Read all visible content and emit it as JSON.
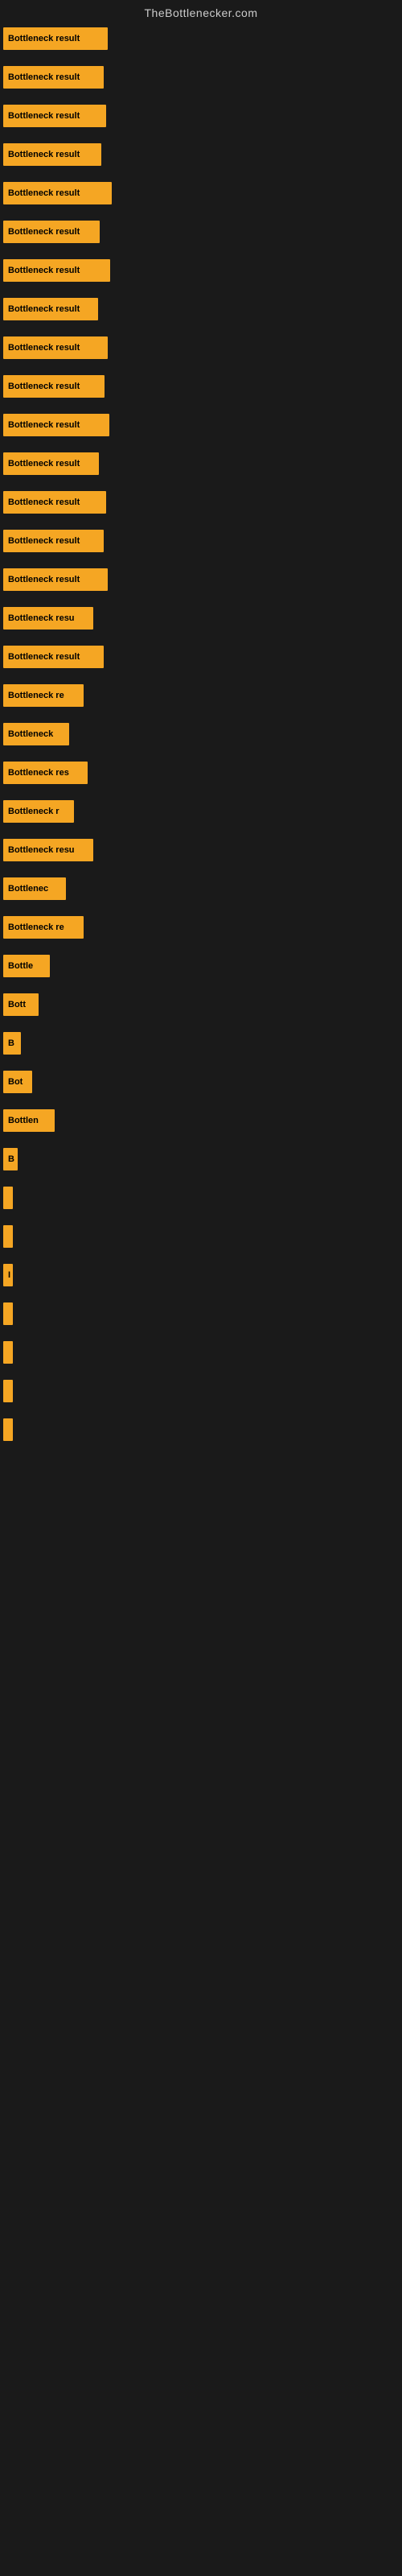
{
  "site": {
    "title": "TheBottlenecker.com"
  },
  "bars": [
    {
      "id": 1,
      "label": "Bottleneck result",
      "width": 130
    },
    {
      "id": 2,
      "label": "Bottleneck result",
      "width": 125
    },
    {
      "id": 3,
      "label": "Bottleneck result",
      "width": 128
    },
    {
      "id": 4,
      "label": "Bottleneck result",
      "width": 122
    },
    {
      "id": 5,
      "label": "Bottleneck result",
      "width": 135
    },
    {
      "id": 6,
      "label": "Bottleneck result",
      "width": 120
    },
    {
      "id": 7,
      "label": "Bottleneck result",
      "width": 133
    },
    {
      "id": 8,
      "label": "Bottleneck result",
      "width": 118
    },
    {
      "id": 9,
      "label": "Bottleneck result",
      "width": 130
    },
    {
      "id": 10,
      "label": "Bottleneck result",
      "width": 126
    },
    {
      "id": 11,
      "label": "Bottleneck result",
      "width": 132
    },
    {
      "id": 12,
      "label": "Bottleneck result",
      "width": 119
    },
    {
      "id": 13,
      "label": "Bottleneck result",
      "width": 128
    },
    {
      "id": 14,
      "label": "Bottleneck result",
      "width": 125
    },
    {
      "id": 15,
      "label": "Bottleneck result",
      "width": 130
    },
    {
      "id": 16,
      "label": "Bottleneck resu",
      "width": 112
    },
    {
      "id": 17,
      "label": "Bottleneck result",
      "width": 125
    },
    {
      "id": 18,
      "label": "Bottleneck re",
      "width": 100
    },
    {
      "id": 19,
      "label": "Bottleneck",
      "width": 82
    },
    {
      "id": 20,
      "label": "Bottleneck res",
      "width": 105
    },
    {
      "id": 21,
      "label": "Bottleneck r",
      "width": 88
    },
    {
      "id": 22,
      "label": "Bottleneck resu",
      "width": 112
    },
    {
      "id": 23,
      "label": "Bottlenec",
      "width": 78
    },
    {
      "id": 24,
      "label": "Bottleneck re",
      "width": 100
    },
    {
      "id": 25,
      "label": "Bottle",
      "width": 58
    },
    {
      "id": 26,
      "label": "Bott",
      "width": 44
    },
    {
      "id": 27,
      "label": "B",
      "width": 22
    },
    {
      "id": 28,
      "label": "Bot",
      "width": 36
    },
    {
      "id": 29,
      "label": "Bottlen",
      "width": 64
    },
    {
      "id": 30,
      "label": "B",
      "width": 18
    },
    {
      "id": 31,
      "label": "",
      "width": 8
    },
    {
      "id": 32,
      "label": "",
      "width": 8
    },
    {
      "id": 33,
      "label": "I",
      "width": 10
    },
    {
      "id": 34,
      "label": "",
      "width": 8
    },
    {
      "id": 35,
      "label": "",
      "width": 8
    },
    {
      "id": 36,
      "label": "",
      "width": 8
    },
    {
      "id": 37,
      "label": "",
      "width": 6
    }
  ]
}
